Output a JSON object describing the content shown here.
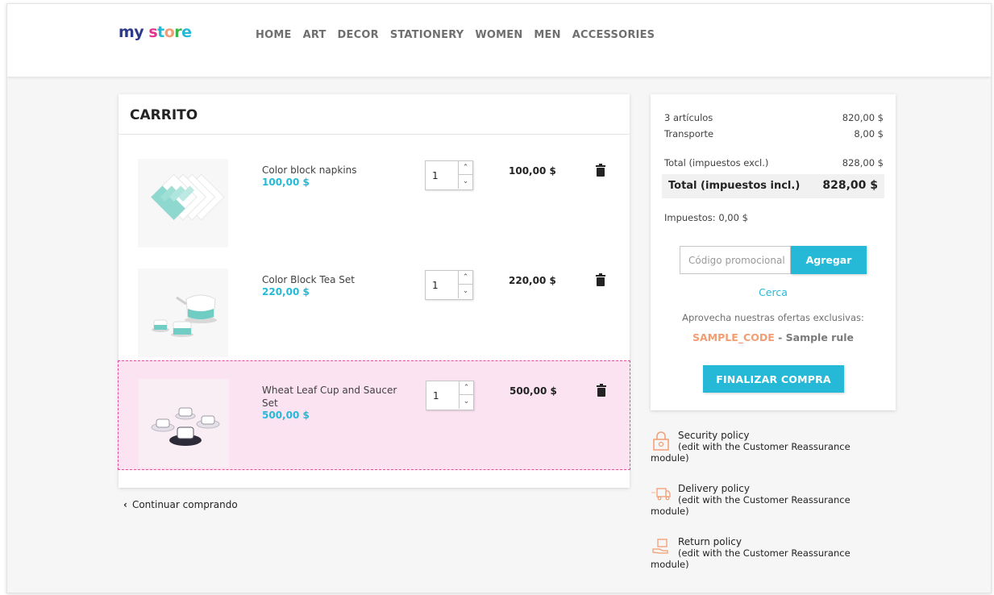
{
  "header": {
    "logo": [
      "my",
      " ",
      "s",
      "t",
      "o",
      "r",
      "e"
    ],
    "nav": [
      "HOME",
      "ART",
      "DECOR",
      "STATIONERY",
      "WOMEN",
      "MEN",
      "ACCESSORIES"
    ]
  },
  "cart": {
    "title": "CARRITO",
    "items": [
      {
        "name": "Color block napkins",
        "price": "100,00 $",
        "qty": "1",
        "total": "100,00 $",
        "icon": "napkins-image"
      },
      {
        "name": "Color Block Tea Set",
        "price": "220,00 $",
        "qty": "1",
        "total": "220,00 $",
        "icon": "tea-set-image"
      },
      {
        "name": "Wheat Leaf Cup and Saucer Set",
        "price": "500,00 $",
        "qty": "1",
        "total": "500,00 $",
        "icon": "cup-saucer-image"
      }
    ],
    "continue_label": "Continuar comprando"
  },
  "summary": {
    "items_label": "3 artículos",
    "items_value": "820,00 $",
    "shipping_label": "Transporte",
    "shipping_value": "8,00 $",
    "total_excl_label": "Total (impuestos excl.)",
    "total_excl_value": "828,00 $",
    "total_incl_label": "Total (impuestos incl.)",
    "total_incl_value": "828,00 $",
    "taxes": "Impuestos: 0,00 $",
    "promo_placeholder": "Código promocional",
    "promo_button": "Agregar",
    "close_link": "Cerca",
    "offers_text": "Aprovecha nuestras ofertas exclusivas:",
    "sample_code": "SAMPLE_CODE",
    "sample_rule": " - Sample rule",
    "checkout_button": "FINALIZAR COMPRA"
  },
  "reassurance": [
    {
      "title": "Security policy",
      "line2": "(edit with the Customer Reassurance",
      "line3": "module)",
      "icon": "lock-icon"
    },
    {
      "title": "Delivery policy",
      "line2": "(edit with the Customer Reassurance",
      "line3": "module)",
      "icon": "truck-icon"
    },
    {
      "title": "Return policy",
      "line2": "(edit with the Customer Reassurance",
      "line3": "module)",
      "icon": "return-box-icon"
    }
  ],
  "colors": {
    "accent": "#25b9d7",
    "highlight": "#fbe3f2",
    "highlight_border": "#e54b9e",
    "code": "#f39d72"
  }
}
